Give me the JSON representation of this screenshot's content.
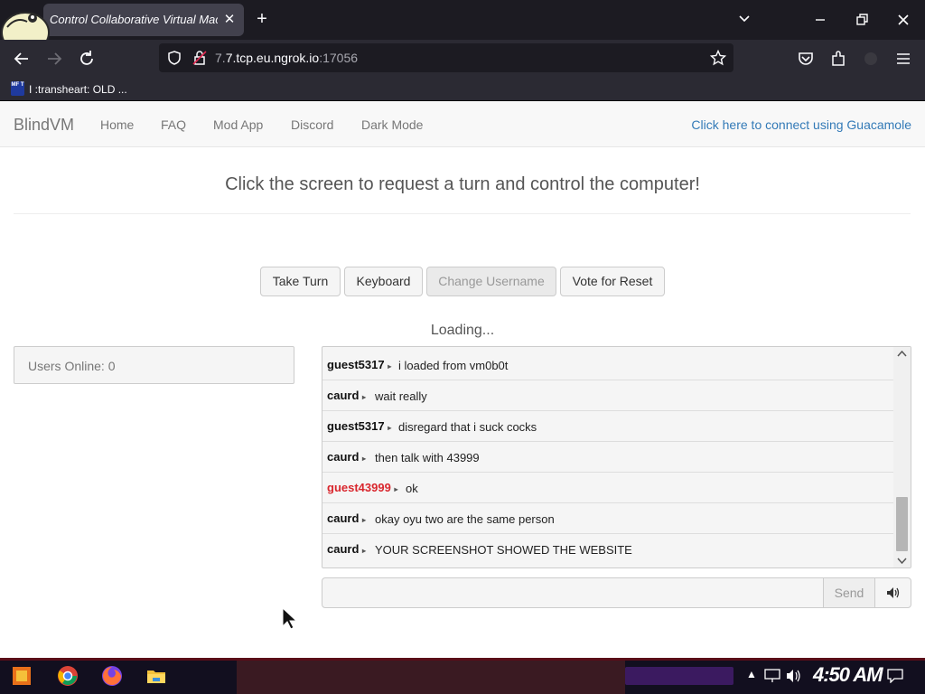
{
  "browser": {
    "tab_title": "Control Collaborative Virtual Machines",
    "url_host": "7.tcp.eu.ngrok.io",
    "url_port": ":17056",
    "bookmark_label": "I :transheart: OLD ...",
    "bookmark_favicon_text": "MF T"
  },
  "site": {
    "brand": "BlindVM",
    "nav": [
      "Home",
      "FAQ",
      "Mod App",
      "Discord",
      "Dark Mode"
    ],
    "guacamole_link": "Click here to connect using Guacamole",
    "headline": "Click the screen to request a turn and control the computer!",
    "buttons": {
      "take_turn": "Take Turn",
      "keyboard": "Keyboard",
      "change_username": "Change Username",
      "vote_reset": "Vote for Reset"
    },
    "loading": "Loading...",
    "users_online": "Users Online: 0",
    "send_label": "Send"
  },
  "chat": {
    "messages": [
      {
        "user": "guest5317",
        "text": "i loaded from vm0b0t",
        "highlight": false
      },
      {
        "user": "caurd",
        "text": "wait really",
        "highlight": false
      },
      {
        "user": "guest5317",
        "text": "disregard that i suck cocks",
        "highlight": false
      },
      {
        "user": "caurd",
        "text": "then talk with 43999",
        "highlight": false
      },
      {
        "user": "guest43999",
        "text": "ok",
        "highlight": true
      },
      {
        "user": "caurd",
        "text": "okay oyu two are the same person",
        "highlight": false
      },
      {
        "user": "caurd",
        "text": "YOUR SCREENSHOT SHOWED THE WEBSITE",
        "highlight": false
      }
    ]
  },
  "taskbar": {
    "clock": "4:50 AM"
  },
  "colors": {
    "accent_link": "#337ab7",
    "highlight_user": "#d9272e"
  }
}
